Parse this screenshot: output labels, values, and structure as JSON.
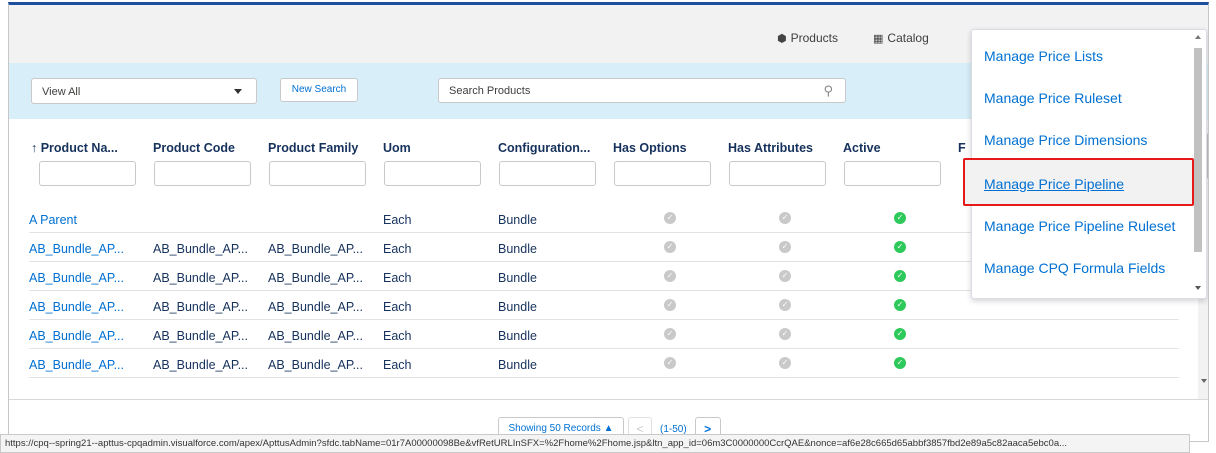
{
  "topnav": {
    "products_label": "Products",
    "products_icon": "cube-icon",
    "catalog_label": "Catalog",
    "catalog_icon": "grid-icon"
  },
  "search": {
    "view_select_value": "View All",
    "new_search_label": "New Search",
    "search_placeholder": "Search Products"
  },
  "table": {
    "headers": [
      "↑ Product Na...",
      "Product Code",
      "Product Family",
      "Uom",
      "Configuration...",
      "Has Options",
      "Has Attributes",
      "Active",
      "F"
    ],
    "rows": [
      {
        "name": "A Parent",
        "code": "",
        "family": "",
        "uom": "Each",
        "config": "Bundle",
        "has_options": false,
        "has_attributes": false,
        "active": true
      },
      {
        "name": "AB_Bundle_AP...",
        "code": "AB_Bundle_AP...",
        "family": "AB_Bundle_AP...",
        "uom": "Each",
        "config": "Bundle",
        "has_options": false,
        "has_attributes": false,
        "active": true
      },
      {
        "name": "AB_Bundle_AP...",
        "code": "AB_Bundle_AP...",
        "family": "AB_Bundle_AP...",
        "uom": "Each",
        "config": "Bundle",
        "has_options": false,
        "has_attributes": false,
        "active": true
      },
      {
        "name": "AB_Bundle_AP...",
        "code": "AB_Bundle_AP...",
        "family": "AB_Bundle_AP...",
        "uom": "Each",
        "config": "Bundle",
        "has_options": false,
        "has_attributes": false,
        "active": true
      },
      {
        "name": "AB_Bundle_AP...",
        "code": "AB_Bundle_AP...",
        "family": "AB_Bundle_AP...",
        "uom": "Each",
        "config": "Bundle",
        "has_options": false,
        "has_attributes": false,
        "active": true
      },
      {
        "name": "AB_Bundle_AP...",
        "code": "AB_Bundle_AP...",
        "family": "AB_Bundle_AP...",
        "uom": "Each",
        "config": "Bundle",
        "has_options": false,
        "has_attributes": false,
        "active": true
      }
    ]
  },
  "pager": {
    "showing_label": "Showing 50 Records ▲",
    "prev_glyph": "<",
    "range": "(1-50)",
    "next_glyph": ">"
  },
  "dropdown": {
    "items": [
      "Manage Price Lists",
      "Manage Price Ruleset",
      "Manage Price Dimensions",
      "Manage Price Pipeline",
      "Manage Price Pipeline Ruleset",
      "Manage CPQ Formula Fields"
    ],
    "highlighted_index": 3,
    "highlight_color": "#e51919"
  },
  "status_url": "https://cpq--spring21--apttus-cpqadmin.visualforce.com/apex/ApttusAdmin?sfdc.tabName=01r7A00000098Be&vfRetURLInSFX=%2Fhome%2Fhome.jsp&ltn_app_id=06m3C0000000CcrQAE&nonce=af6e28c665d65abbf3857fbd2e89a5c82aaca5ebc0a...",
  "colors": {
    "link": "#0070d2",
    "active_check": "#2ec95b",
    "inactive_check": "#c9c9c9",
    "search_band": "#d8eef8"
  }
}
